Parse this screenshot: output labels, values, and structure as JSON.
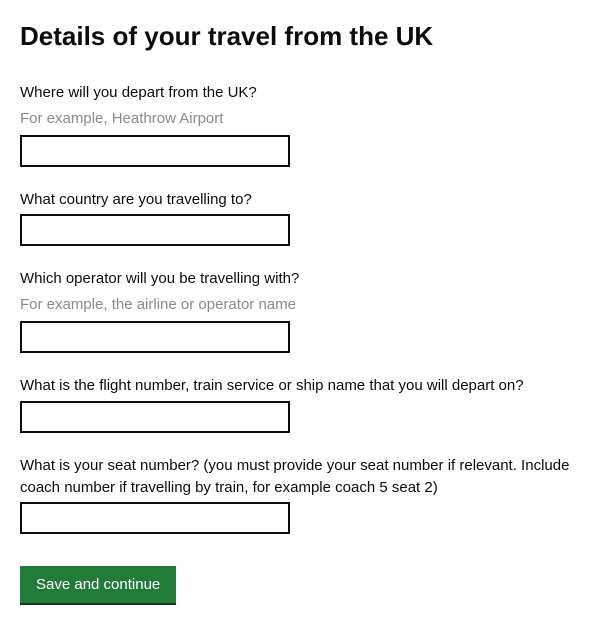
{
  "page": {
    "title": "Details of your travel from the UK"
  },
  "fields": {
    "depart_from": {
      "label": "Where will you depart from the UK?",
      "hint": "For example, Heathrow Airport",
      "value": ""
    },
    "destination_country": {
      "label": "What country are you travelling to?",
      "value": ""
    },
    "operator": {
      "label": "Which operator will you be travelling with?",
      "hint": "For example, the airline or operator name",
      "value": ""
    },
    "flight_number": {
      "label": "What is the flight number, train service or ship name that you will depart on?",
      "value": ""
    },
    "seat_number": {
      "label": "What is your seat number? (you must provide your seat number if relevant. Include coach number if travelling by train, for example coach 5 seat 2)",
      "value": ""
    }
  },
  "actions": {
    "submit_label": "Save and continue"
  }
}
